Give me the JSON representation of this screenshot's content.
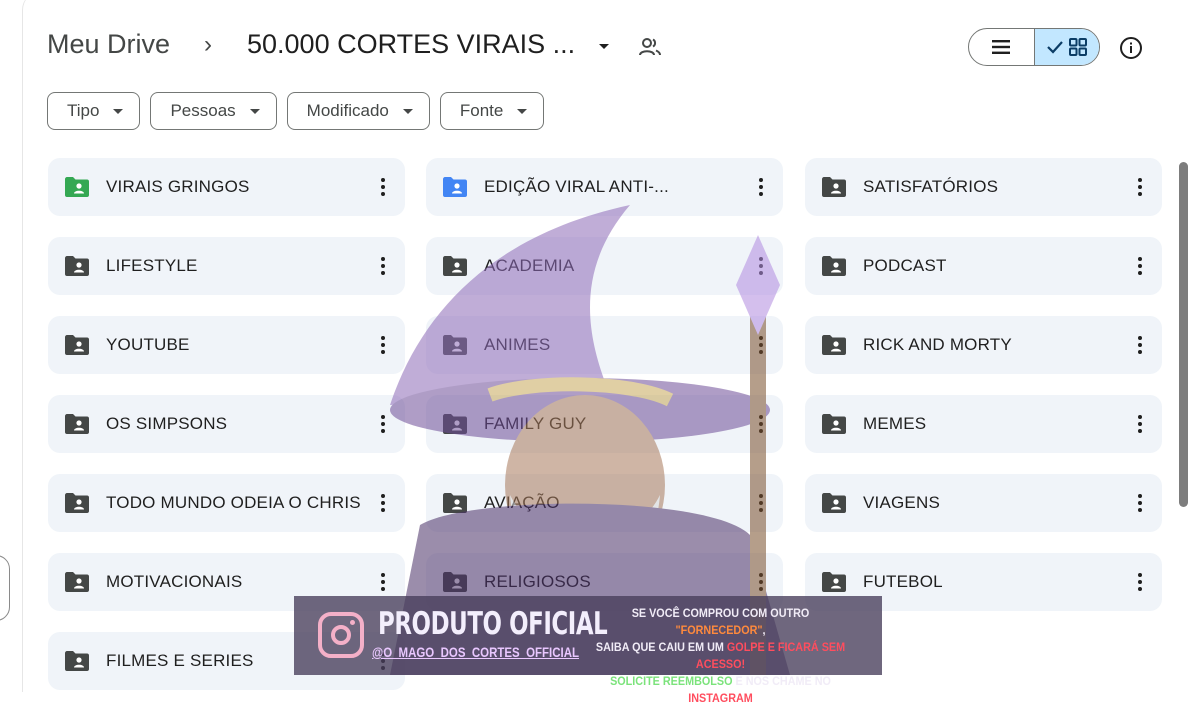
{
  "header": {
    "root": "Meu Drive",
    "separator": "›",
    "current_folder": "50.000 CORTES VIRAIS ..."
  },
  "filters": [
    {
      "label": "Tipo"
    },
    {
      "label": "Pessoas"
    },
    {
      "label": "Modificado"
    },
    {
      "label": "Fonte"
    }
  ],
  "folders": [
    {
      "name": "VIRAIS GRINGOS",
      "color": "#34a853"
    },
    {
      "name": "EDIÇÃO VIRAL ANTI-...",
      "color": "#4285f4"
    },
    {
      "name": "SATISFATÓRIOS",
      "color": "#444746"
    },
    {
      "name": "LIFESTYLE",
      "color": "#444746"
    },
    {
      "name": "ACADEMIA",
      "color": "#444746"
    },
    {
      "name": "PODCAST",
      "color": "#444746"
    },
    {
      "name": "YOUTUBE",
      "color": "#444746"
    },
    {
      "name": "ANIMES",
      "color": "#444746"
    },
    {
      "name": "RICK AND MORTY",
      "color": "#444746"
    },
    {
      "name": "OS SIMPSONS",
      "color": "#444746"
    },
    {
      "name": "FAMILY GUY",
      "color": "#444746"
    },
    {
      "name": "MEMES",
      "color": "#444746"
    },
    {
      "name": "TODO MUNDO ODEIA O CHRIS",
      "color": "#444746"
    },
    {
      "name": "AVIAÇÃO",
      "color": "#444746"
    },
    {
      "name": "VIAGENS",
      "color": "#444746"
    },
    {
      "name": "MOTIVACIONAIS",
      "color": "#444746"
    },
    {
      "name": "RELIGIOSOS",
      "color": "#444746"
    },
    {
      "name": "FUTEBOL",
      "color": "#444746"
    },
    {
      "name": "FILMES E SERIES",
      "color": "#444746"
    }
  ],
  "banner": {
    "title": "PRODUTO OFICIAL",
    "handle": "@O_MAGO_DOS_CORTES_OFFICIAL",
    "line1_a": "SE VOCÊ COMPROU COM OUTRO ",
    "line1_b": "\"FORNECEDOR\"",
    "line1_c": ",",
    "line2_a": "SAIBA QUE CAIU EM UM ",
    "line2_b": "GOLPE E FICARÁ SEM ACESSO!",
    "line3_a": "SOLICITE REEMBOLSO",
    "line3_b": " E NOS CHAME NO ",
    "line3_c": "INSTAGRAM"
  }
}
